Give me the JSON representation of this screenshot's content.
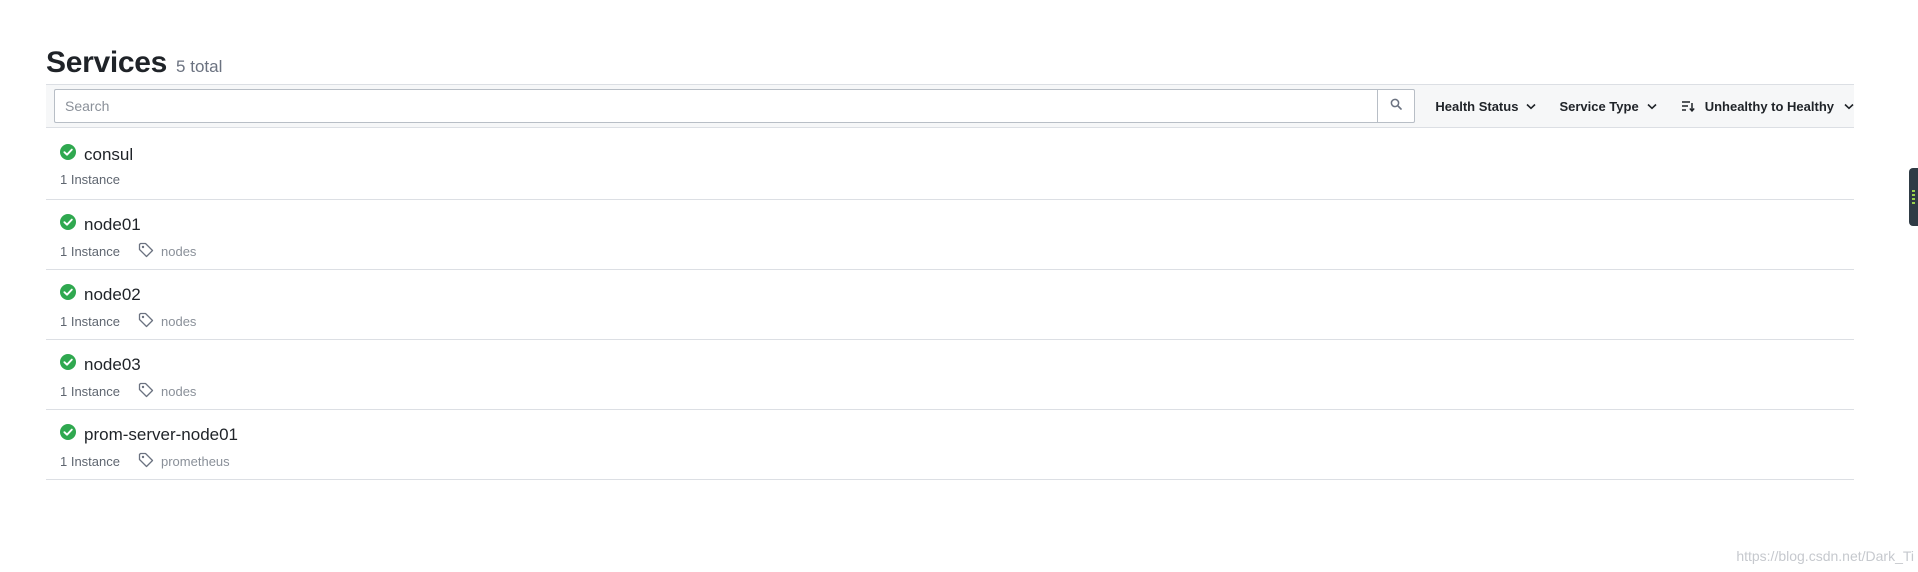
{
  "header": {
    "title": "Services",
    "count_label": "5 total"
  },
  "filters": {
    "search_placeholder": "Search",
    "health_status": "Health Status",
    "service_type": "Service Type",
    "sort": "Unhealthy to Healthy"
  },
  "services": [
    {
      "name": "consul",
      "instances": "1 Instance",
      "tag": "",
      "status": "passing"
    },
    {
      "name": "node01",
      "instances": "1 Instance",
      "tag": "nodes",
      "status": "passing"
    },
    {
      "name": "node02",
      "instances": "1 Instance",
      "tag": "nodes",
      "status": "passing"
    },
    {
      "name": "node03",
      "instances": "1 Instance",
      "tag": "nodes",
      "status": "passing"
    },
    {
      "name": "prom-server-node01",
      "instances": "1 Instance",
      "tag": "prometheus",
      "status": "passing"
    }
  ],
  "icons": {
    "search": "search-icon",
    "chevron": "chevron-down-icon",
    "sort": "sort-icon",
    "status": "check-circle-icon",
    "tag": "tag-icon"
  },
  "colors": {
    "passing": "#2fa84f",
    "border": "#dcdfe4"
  },
  "watermark": "https://blog.csdn.net/Dark_Ti"
}
